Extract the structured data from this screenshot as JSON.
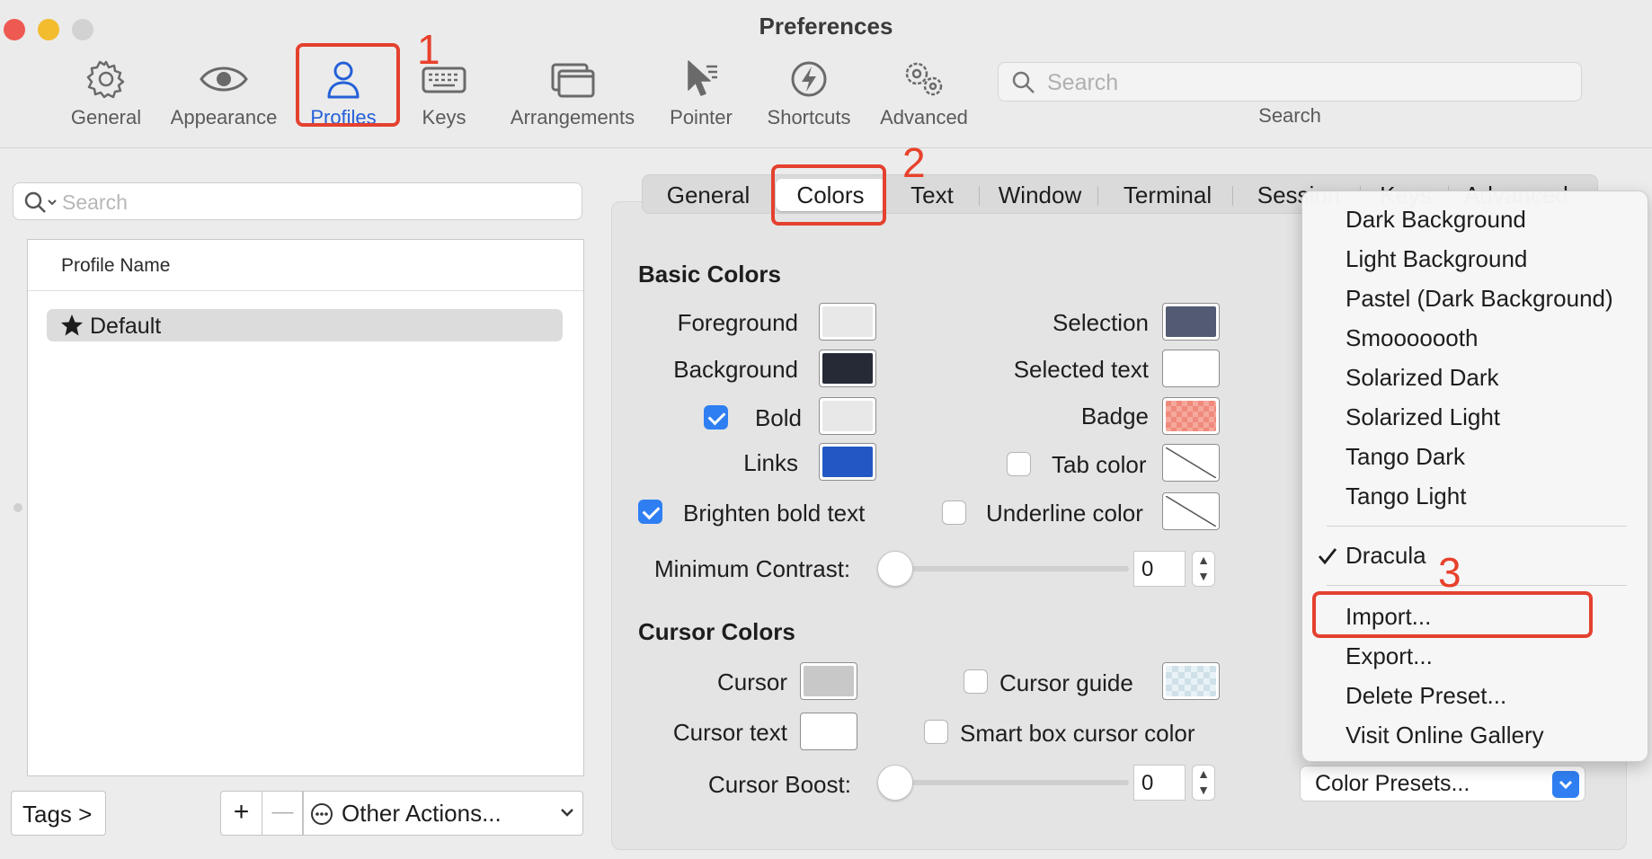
{
  "window": {
    "title": "Preferences"
  },
  "toolbar": {
    "items": [
      {
        "label": "General",
        "icon": "gear-icon"
      },
      {
        "label": "Appearance",
        "icon": "eye-icon"
      },
      {
        "label": "Profiles",
        "icon": "person-icon",
        "active": true
      },
      {
        "label": "Keys",
        "icon": "keyboard-icon"
      },
      {
        "label": "Arrangements",
        "icon": "windows-icon"
      },
      {
        "label": "Pointer",
        "icon": "pointer-icon"
      },
      {
        "label": "Shortcuts",
        "icon": "lightning-icon"
      },
      {
        "label": "Advanced",
        "icon": "gears-icon"
      }
    ],
    "search": {
      "placeholder": "Search",
      "label": "Search"
    }
  },
  "annotations": {
    "step1": "1",
    "step2": "2",
    "step3": "3",
    "color": "#e4412f"
  },
  "profiles": {
    "search_placeholder": "Search",
    "column_header": "Profile Name",
    "items": [
      {
        "name": "Default",
        "default": true,
        "selected": true
      }
    ],
    "tags_button": "Tags >",
    "add_button": "+",
    "remove_button": "—",
    "other_actions": "Other Actions..."
  },
  "tabs": [
    "General",
    "Colors",
    "Text",
    "Window",
    "Terminal",
    "Session",
    "Keys",
    "Advanced"
  ],
  "active_tab": "Colors",
  "basic_colors": {
    "title": "Basic Colors",
    "foreground": {
      "label": "Foreground",
      "color": "#e8e8e8"
    },
    "background": {
      "label": "Background",
      "color": "#262a36"
    },
    "bold": {
      "label": "Bold",
      "color": "#e8e8e8",
      "checked": true
    },
    "links": {
      "label": "Links",
      "color": "#2358c4"
    },
    "brighten_bold": {
      "label": "Brighten bold text",
      "checked": true
    },
    "selection": {
      "label": "Selection",
      "color": "#535a73"
    },
    "selected_text": {
      "label": "Selected text",
      "color": "#ffffff"
    },
    "badge": {
      "label": "Badge",
      "color": "#f08a7c"
    },
    "tab_color": {
      "label": "Tab color",
      "checked": false
    },
    "underline_color": {
      "label": "Underline color",
      "checked": false
    },
    "minimum_contrast": {
      "label": "Minimum Contrast:",
      "value": "0"
    }
  },
  "cursor_colors": {
    "title": "Cursor Colors",
    "cursor": {
      "label": "Cursor",
      "color": "#c8c8c8"
    },
    "cursor_text": {
      "label": "Cursor text",
      "color": "#ffffff"
    },
    "cursor_guide": {
      "label": "Cursor guide",
      "checked": false
    },
    "smart_box": {
      "label": "Smart box cursor color",
      "checked": false
    },
    "cursor_boost": {
      "label": "Cursor Boost:",
      "value": "0"
    }
  },
  "presets_menu": {
    "items": [
      "Dark Background",
      "Light Background",
      "Pastel (Dark Background)",
      "Smooooooth",
      "Solarized Dark",
      "Solarized Light",
      "Tango Dark",
      "Tango Light"
    ],
    "checked_item": "Dracula",
    "actions": [
      "Import...",
      "Export...",
      "Delete Preset...",
      "Visit Online Gallery"
    ]
  },
  "color_presets_button": "Color Presets..."
}
